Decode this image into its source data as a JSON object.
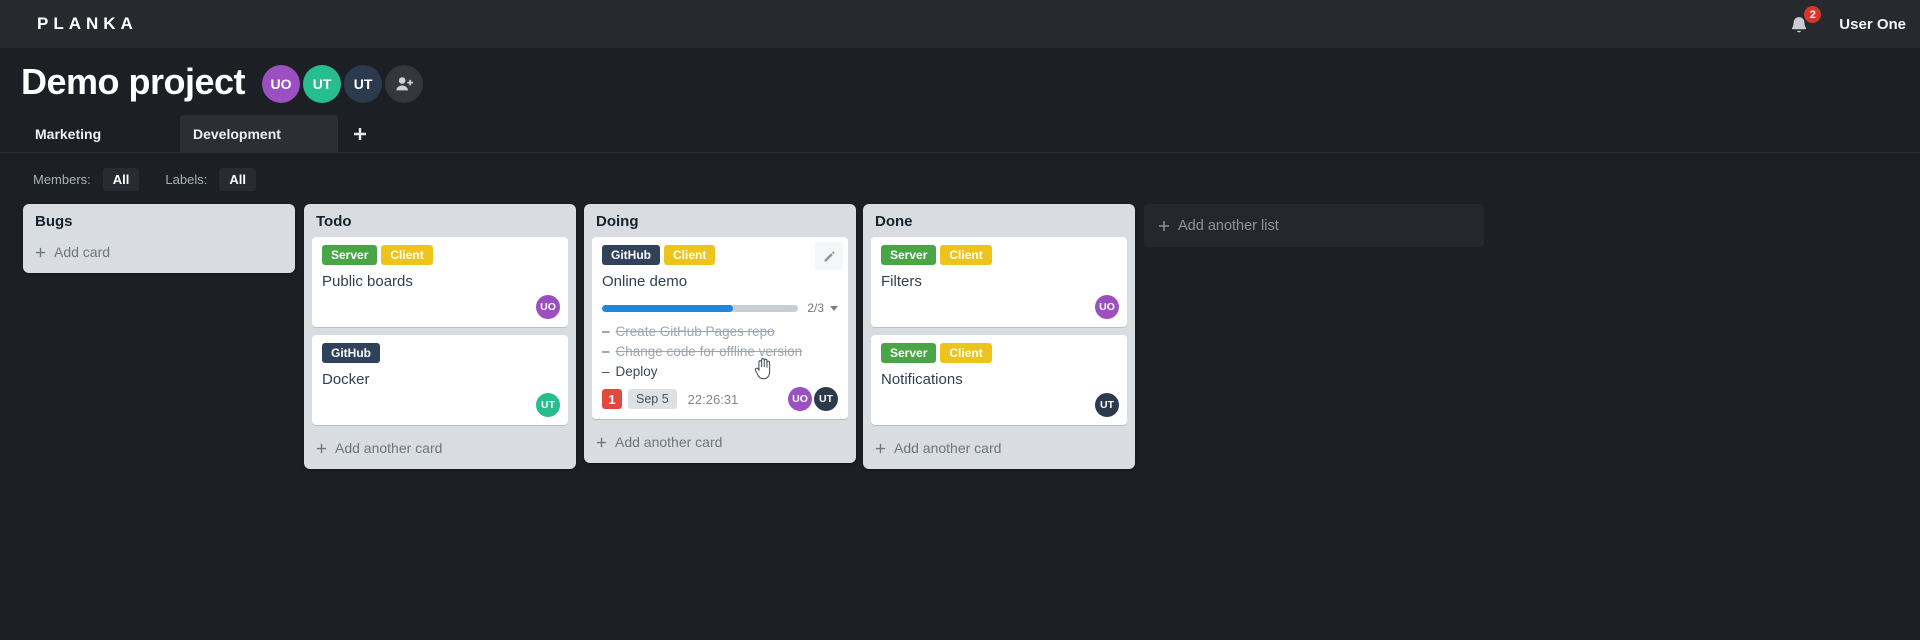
{
  "topbar": {
    "logo": "PLANKA",
    "bell_badge": "2",
    "user_name": "User One"
  },
  "project": {
    "title": "Demo project",
    "members": [
      {
        "initials": "UO",
        "color": "#9b4fc0"
      },
      {
        "initials": "UT",
        "color": "#27bd8f"
      },
      {
        "initials": "UT",
        "color": "#2c3a4d"
      }
    ]
  },
  "tabs": {
    "marketing": "Marketing",
    "development": "Development"
  },
  "filters": {
    "members_label": "Members:",
    "members_value": "All",
    "labels_label": "Labels:",
    "labels_value": "All"
  },
  "ui": {
    "task_bullet": "–"
  },
  "colors": {
    "progress_blue": "#2187d8",
    "notification_red": "#e2483d",
    "label_green": "#4aa546",
    "label_yellow": "#eec41c",
    "label_navy": "#30415a"
  },
  "board": {
    "add_list_label": "Add another list",
    "lists": [
      {
        "title": "Bugs",
        "add_label": "Add card",
        "cards": []
      },
      {
        "title": "Todo",
        "add_label": "Add another card",
        "cards": [
          {
            "title": "Public boards",
            "labels": [
              {
                "text": "Server",
                "color": "#4aa546"
              },
              {
                "text": "Client",
                "color": "#eec41c"
              }
            ],
            "member": {
              "initials": "UO",
              "color": "#9b4fc0"
            }
          },
          {
            "title": "Docker",
            "labels": [
              {
                "text": "GitHub",
                "color": "#30415a"
              }
            ],
            "member": {
              "initials": "UT",
              "color": "#27bd8f"
            }
          }
        ]
      },
      {
        "title": "Doing",
        "add_label": "Add another card",
        "cards": [
          {
            "title": "Online demo",
            "labels": [
              {
                "text": "GitHub",
                "color": "#30415a"
              },
              {
                "text": "Client",
                "color": "#eec41c"
              }
            ],
            "progress": {
              "completed": 2,
              "total": 3,
              "display": "2/3"
            },
            "tasks": [
              {
                "text": "Create GitHub Pages repo",
                "done": true
              },
              {
                "text": "Change code for offline version",
                "done": true
              },
              {
                "text": "Deploy",
                "done": false
              }
            ],
            "notification_count": "1",
            "due_date": "Sep 5",
            "timer": "22:26:31",
            "members": [
              {
                "initials": "UO",
                "color": "#9b4fc0"
              },
              {
                "initials": "UT",
                "color": "#2c3a4d"
              }
            ]
          }
        ]
      },
      {
        "title": "Done",
        "add_label": "Add another card",
        "cards": [
          {
            "title": "Filters",
            "labels": [
              {
                "text": "Server",
                "color": "#4aa546"
              },
              {
                "text": "Client",
                "color": "#eec41c"
              }
            ],
            "member": {
              "initials": "UO",
              "color": "#9b4fc0"
            }
          },
          {
            "title": "Notifications",
            "labels": [
              {
                "text": "Server",
                "color": "#4aa546"
              },
              {
                "text": "Client",
                "color": "#eec41c"
              }
            ],
            "member": {
              "initials": "UT",
              "color": "#2c3a4d"
            }
          }
        ]
      }
    ]
  }
}
